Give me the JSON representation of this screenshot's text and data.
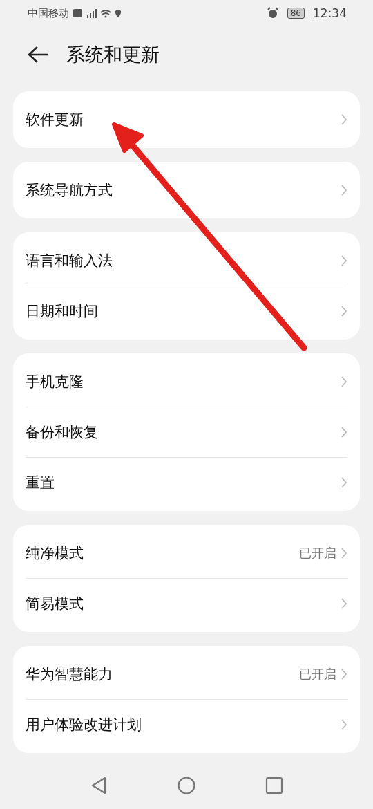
{
  "status_bar": {
    "carrier": "中国移动",
    "battery": "86",
    "time": "12:34"
  },
  "header": {
    "title": "系统和更新"
  },
  "groups": [
    {
      "items": [
        {
          "label": "软件更新"
        }
      ]
    },
    {
      "items": [
        {
          "label": "系统导航方式"
        }
      ]
    },
    {
      "items": [
        {
          "label": "语言和输入法"
        },
        {
          "label": "日期和时间"
        }
      ]
    },
    {
      "items": [
        {
          "label": "手机克隆"
        },
        {
          "label": "备份和恢复"
        },
        {
          "label": "重置"
        }
      ]
    },
    {
      "items": [
        {
          "label": "纯净模式",
          "value": "已开启"
        },
        {
          "label": "简易模式"
        }
      ]
    },
    {
      "items": [
        {
          "label": "华为智慧能力",
          "value": "已开启"
        },
        {
          "label": "用户体验改进计划"
        }
      ]
    }
  ]
}
